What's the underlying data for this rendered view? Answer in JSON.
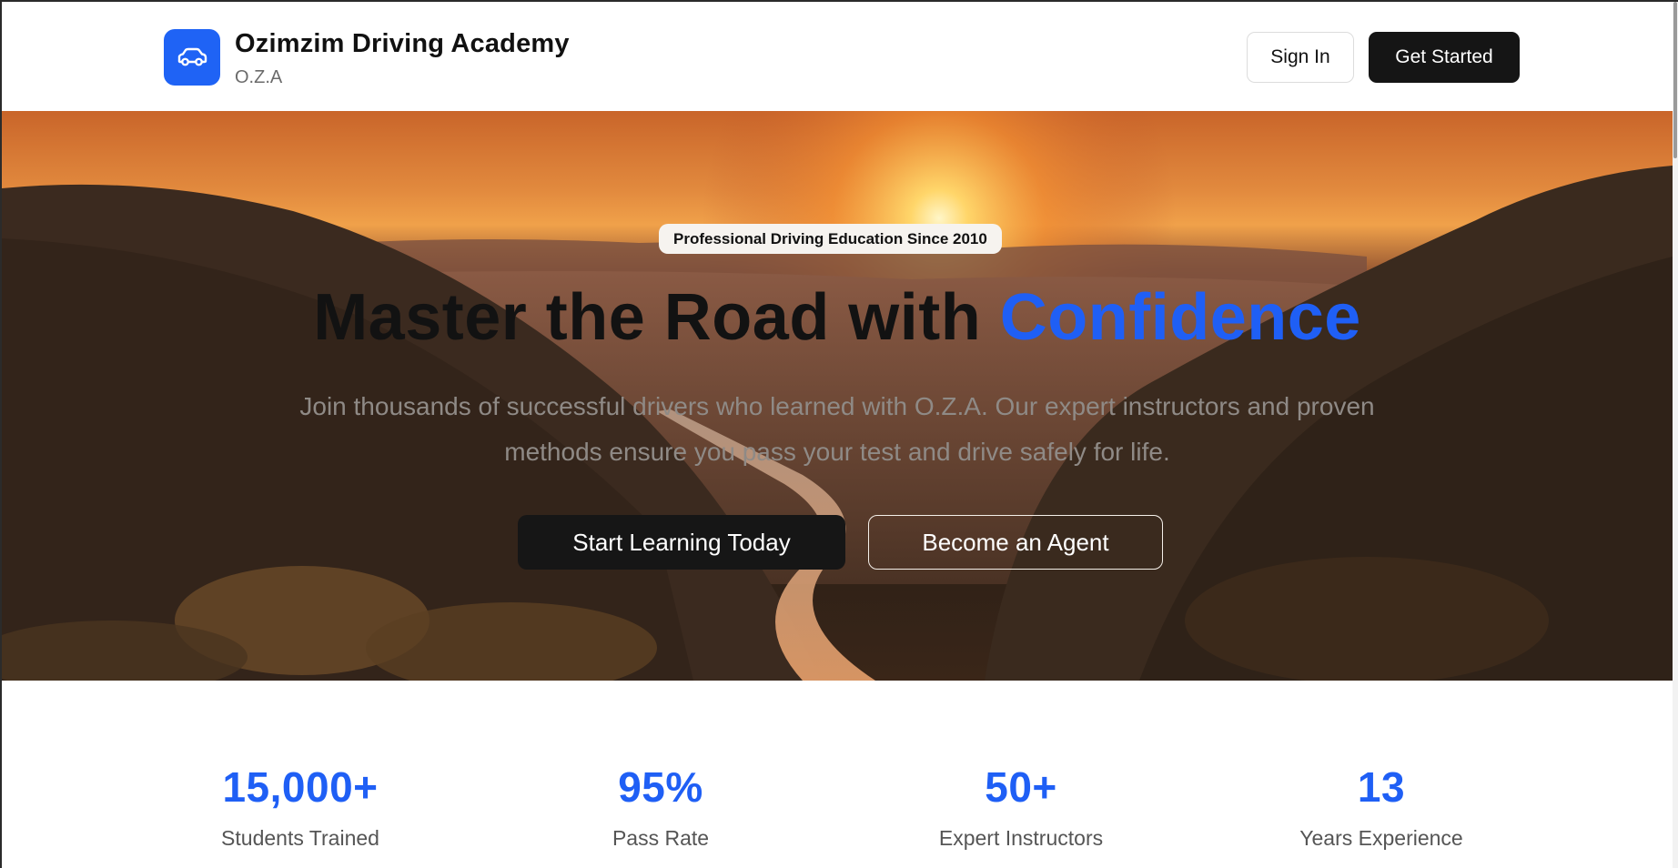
{
  "header": {
    "brand_name": "Ozimzim Driving Academy",
    "brand_sub": "O.Z.A",
    "logo_icon": "car-icon",
    "signin_label": "Sign In",
    "getstarted_label": "Get Started"
  },
  "hero": {
    "badge": "Professional Driving Education Since 2010",
    "title_main": "Master the Road with ",
    "title_accent": "Confidence",
    "subtitle": "Join thousands of successful drivers who learned with O.Z.A. Our expert instructors and proven methods ensure you pass your test and drive safely for life.",
    "primary_cta": "Start Learning Today",
    "secondary_cta": "Become an Agent"
  },
  "stats": [
    {
      "value": "15,000+",
      "label": "Students Trained"
    },
    {
      "value": "95%",
      "label": "Pass Rate"
    },
    {
      "value": "50+",
      "label": "Expert Instructors"
    },
    {
      "value": "13",
      "label": "Years Experience"
    }
  ],
  "colors": {
    "brand_blue": "#1f5ff5",
    "dark_button": "#151515"
  }
}
